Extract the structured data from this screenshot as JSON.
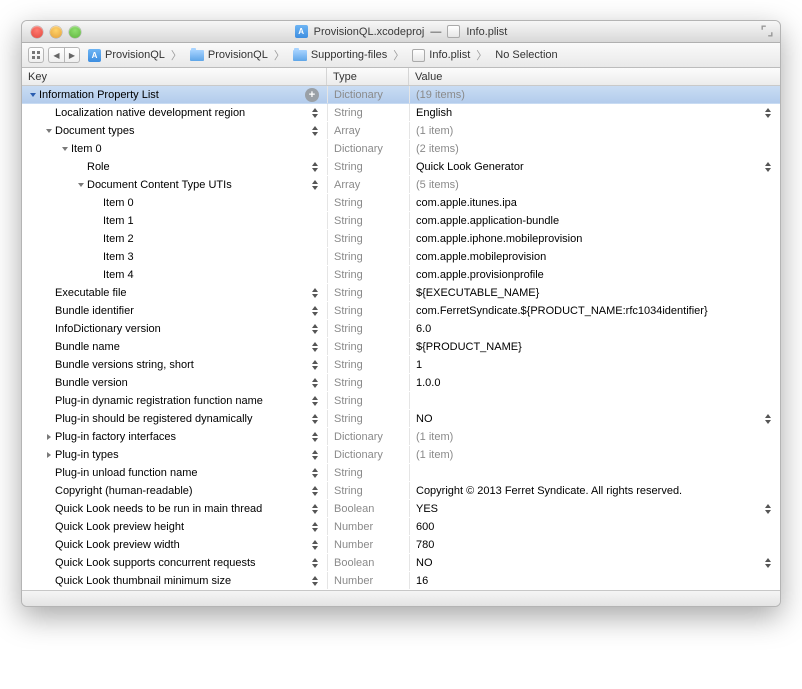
{
  "title": {
    "proj": "ProvisionQL.xcodeproj",
    "sep": "—",
    "file": "Info.plist"
  },
  "breadcrumbs": [
    "ProvisionQL",
    "ProvisionQL",
    "Supporting-files",
    "Info.plist",
    "No Selection"
  ],
  "columns": {
    "key": "Key",
    "type": "Type",
    "value": "Value"
  },
  "rows": [
    {
      "indent": 0,
      "disc": "open",
      "key": "Information Property List",
      "type": "Dictionary",
      "value": "(19 items)",
      "sel": true,
      "plus": true,
      "vgray": true
    },
    {
      "indent": 1,
      "key": "Localization native development region",
      "type": "String",
      "value": "English",
      "step": true,
      "vstep": true
    },
    {
      "indent": 1,
      "disc": "open",
      "key": "Document types",
      "type": "Array",
      "value": "(1 item)",
      "step": true,
      "vgray": true
    },
    {
      "indent": 2,
      "disc": "open",
      "key": "Item 0",
      "type": "Dictionary",
      "value": "(2 items)",
      "vgray": true
    },
    {
      "indent": 3,
      "key": "Role",
      "type": "String",
      "value": "Quick Look Generator",
      "step": true,
      "vstep": true
    },
    {
      "indent": 3,
      "disc": "open",
      "key": "Document Content Type UTIs",
      "type": "Array",
      "value": "(5 items)",
      "step": true,
      "vgray": true
    },
    {
      "indent": 4,
      "key": "Item 0",
      "type": "String",
      "value": "com.apple.itunes.ipa"
    },
    {
      "indent": 4,
      "key": "Item 1",
      "type": "String",
      "value": "com.apple.application-bundle"
    },
    {
      "indent": 4,
      "key": "Item 2",
      "type": "String",
      "value": "com.apple.iphone.mobileprovision"
    },
    {
      "indent": 4,
      "key": "Item 3",
      "type": "String",
      "value": "com.apple.mobileprovision"
    },
    {
      "indent": 4,
      "key": "Item 4",
      "type": "String",
      "value": "com.apple.provisionprofile"
    },
    {
      "indent": 1,
      "key": "Executable file",
      "type": "String",
      "value": "${EXECUTABLE_NAME}",
      "step": true
    },
    {
      "indent": 1,
      "key": "Bundle identifier",
      "type": "String",
      "value": "com.FerretSyndicate.${PRODUCT_NAME:rfc1034identifier}",
      "step": true
    },
    {
      "indent": 1,
      "key": "InfoDictionary version",
      "type": "String",
      "value": "6.0",
      "step": true
    },
    {
      "indent": 1,
      "key": "Bundle name",
      "type": "String",
      "value": "${PRODUCT_NAME}",
      "step": true
    },
    {
      "indent": 1,
      "key": "Bundle versions string, short",
      "type": "String",
      "value": "1",
      "step": true
    },
    {
      "indent": 1,
      "key": "Bundle version",
      "type": "String",
      "value": "1.0.0",
      "step": true
    },
    {
      "indent": 1,
      "key": "Plug-in dynamic registration function name",
      "type": "String",
      "value": "",
      "step": true
    },
    {
      "indent": 1,
      "key": "Plug-in should be registered dynamically",
      "type": "String",
      "value": "NO",
      "step": true,
      "vstep": true
    },
    {
      "indent": 1,
      "disc": "closed",
      "key": "Plug-in factory interfaces",
      "type": "Dictionary",
      "value": "(1 item)",
      "step": true,
      "vgray": true
    },
    {
      "indent": 1,
      "disc": "closed",
      "key": "Plug-in types",
      "type": "Dictionary",
      "value": "(1 item)",
      "step": true,
      "vgray": true
    },
    {
      "indent": 1,
      "key": "Plug-in unload function name",
      "type": "String",
      "value": "",
      "step": true
    },
    {
      "indent": 1,
      "key": "Copyright (human-readable)",
      "type": "String",
      "value": "Copyright © 2013 Ferret Syndicate. All rights reserved.",
      "step": true
    },
    {
      "indent": 1,
      "key": "Quick Look needs to be run in main thread",
      "type": "Boolean",
      "value": "YES",
      "step": true,
      "vstep": true
    },
    {
      "indent": 1,
      "key": "Quick Look preview height",
      "type": "Number",
      "value": "600",
      "step": true
    },
    {
      "indent": 1,
      "key": "Quick Look preview width",
      "type": "Number",
      "value": "780",
      "step": true
    },
    {
      "indent": 1,
      "key": "Quick Look supports concurrent requests",
      "type": "Boolean",
      "value": "NO",
      "step": true,
      "vstep": true
    },
    {
      "indent": 1,
      "key": "Quick Look thumbnail minimum size",
      "type": "Number",
      "value": "16",
      "step": true
    }
  ]
}
